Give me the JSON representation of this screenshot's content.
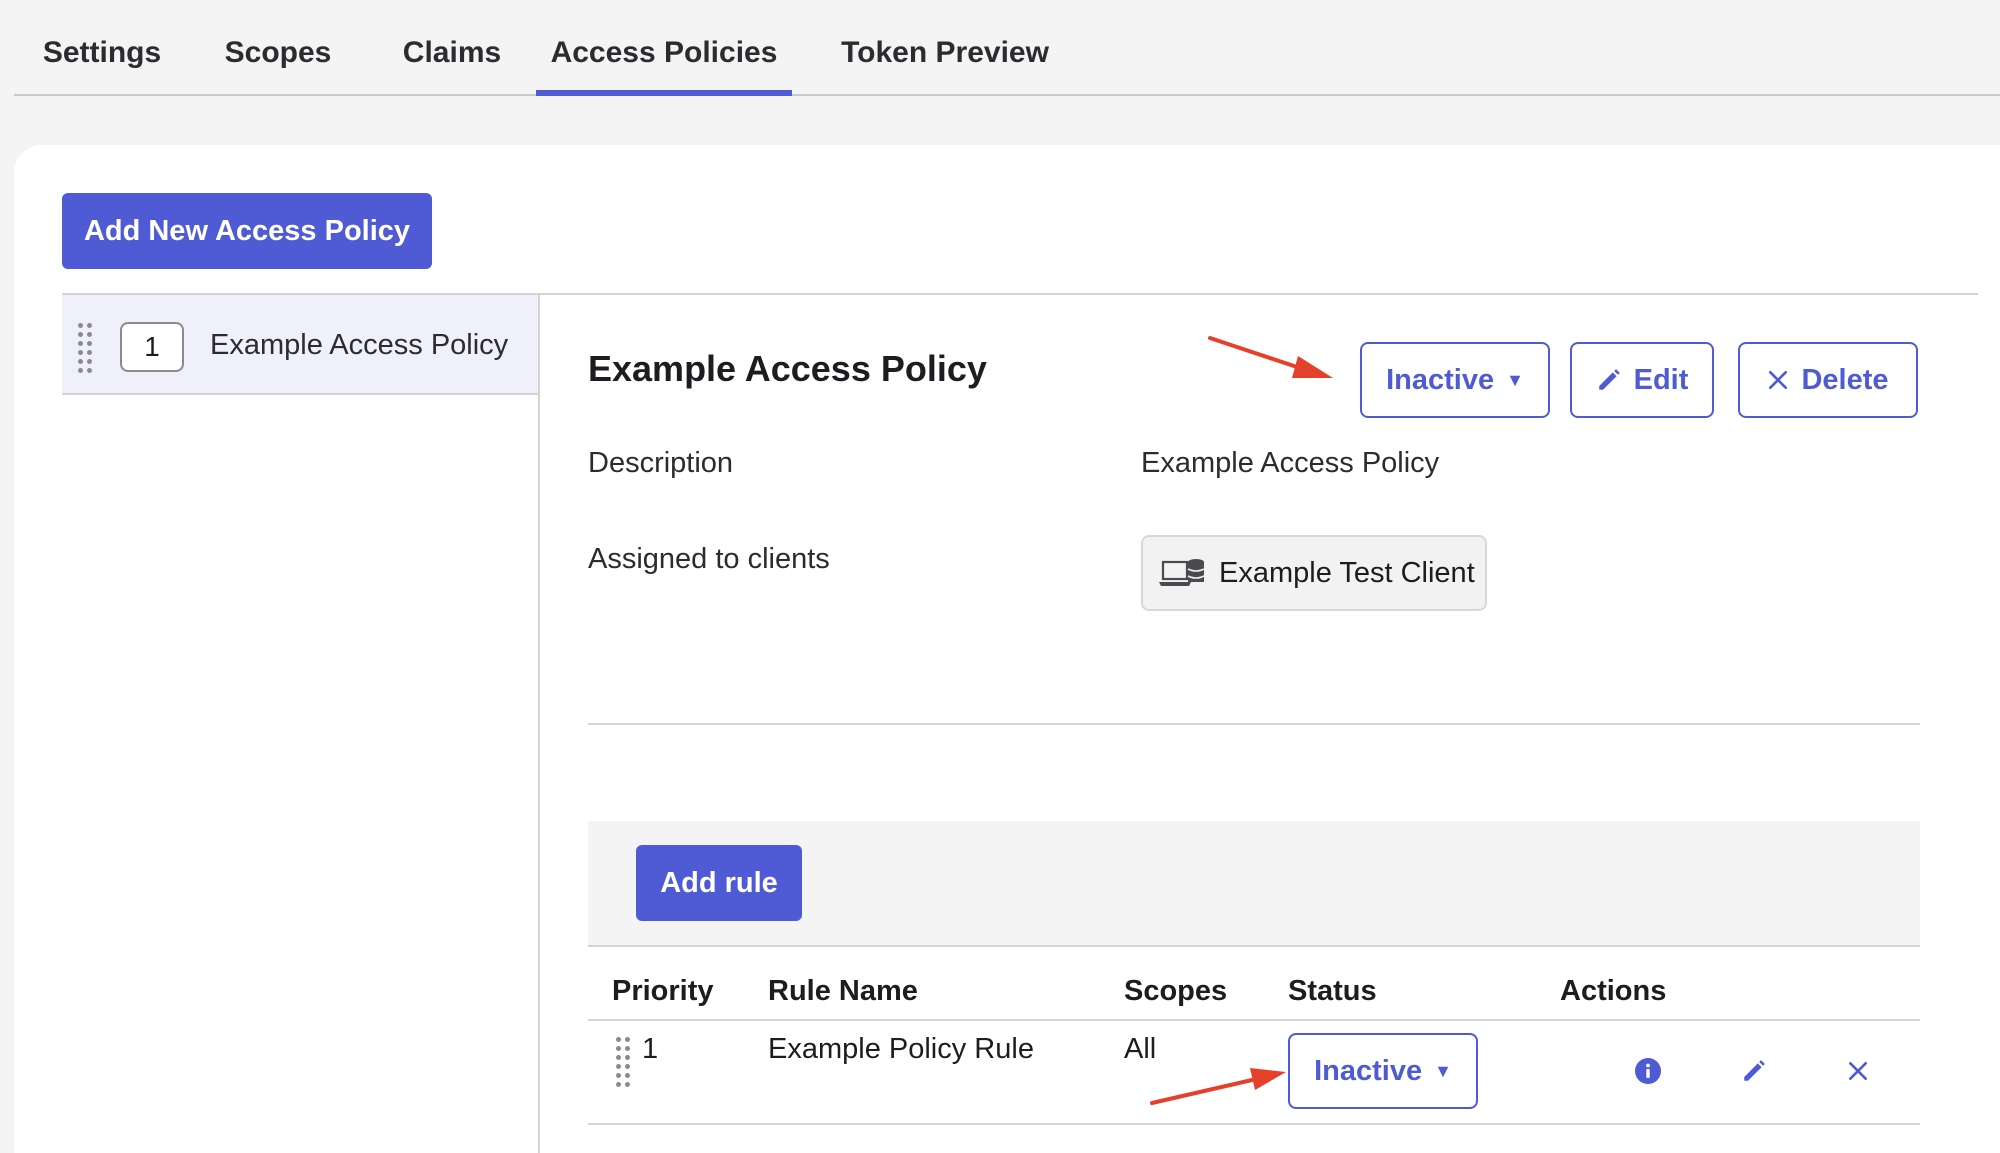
{
  "tabs": [
    {
      "label": "Settings"
    },
    {
      "label": "Scopes"
    },
    {
      "label": "Claims"
    },
    {
      "label": "Access Policies"
    },
    {
      "label": "Token Preview"
    }
  ],
  "add_policy_button": "Add New Access Policy",
  "policy_list": [
    {
      "priority": "1",
      "name": "Example Access Policy"
    }
  ],
  "policy": {
    "title": "Example Access Policy",
    "status": "Inactive",
    "edit_label": "Edit",
    "delete_label": "Delete",
    "description_label": "Description",
    "description_value": "Example Access Policy",
    "assigned_label": "Assigned to clients",
    "client_name": "Example Test Client"
  },
  "rules": {
    "add_rule_label": "Add rule",
    "columns": [
      "Priority",
      "Rule Name",
      "Scopes",
      "Status",
      "Actions"
    ],
    "rows": [
      {
        "priority": "1",
        "name": "Example Policy Rule",
        "scopes": "All",
        "status": "Inactive"
      }
    ]
  },
  "colors": {
    "accent": "#4f5bd5",
    "annotation_arrow": "#e5402a"
  },
  "icons": [
    "drag-handle-icon",
    "pencil-icon",
    "close-icon",
    "laptop-server-icon",
    "info-icon",
    "caret-down-icon"
  ]
}
